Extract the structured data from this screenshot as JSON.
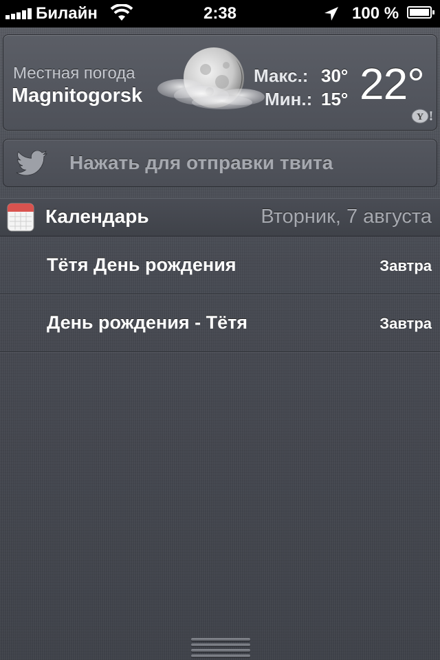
{
  "status_bar": {
    "carrier": "Билайн",
    "time": "2:38",
    "battery": "100 %",
    "battery_level": 1.0,
    "signal_bars": 5,
    "icons": [
      "signal-bars-icon",
      "wifi-icon",
      "location-arrow-icon",
      "battery-icon"
    ]
  },
  "weather": {
    "label": "Местная погода",
    "city": "Magnitogorsk",
    "max_label": "Макс.:",
    "max_value": "30°",
    "min_label": "Мин.:",
    "min_value": "15°",
    "temperature": "22°",
    "condition_icon": "moon-with-clouds-icon",
    "provider_icon": "yahoo-icon"
  },
  "twitter": {
    "label": "Нажать для отправки твита",
    "icon": "twitter-bird-icon"
  },
  "calendar": {
    "title": "Календарь",
    "date": "Вторник, 7 августа",
    "events": [
      {
        "title": "Тётя День рождения",
        "when": "Завтра"
      },
      {
        "title": "День рождения - Тётя",
        "when": "Завтра"
      }
    ]
  },
  "colors": {
    "background": "#4b4e56",
    "status_bar": "#000000",
    "calendar_icon_red": "#d9534f"
  }
}
